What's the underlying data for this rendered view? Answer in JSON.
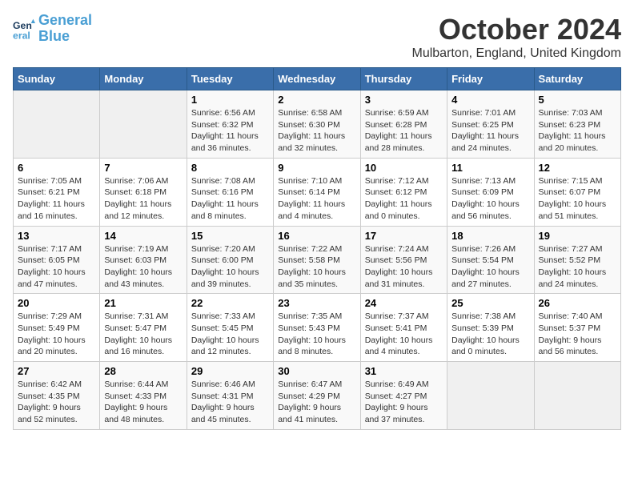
{
  "logo": {
    "line1": "General",
    "line2": "Blue"
  },
  "title": "October 2024",
  "location": "Mulbarton, England, United Kingdom",
  "days_of_week": [
    "Sunday",
    "Monday",
    "Tuesday",
    "Wednesday",
    "Thursday",
    "Friday",
    "Saturday"
  ],
  "weeks": [
    [
      {
        "day": "",
        "detail": ""
      },
      {
        "day": "",
        "detail": ""
      },
      {
        "day": "1",
        "detail": "Sunrise: 6:56 AM\nSunset: 6:32 PM\nDaylight: 11 hours\nand 36 minutes."
      },
      {
        "day": "2",
        "detail": "Sunrise: 6:58 AM\nSunset: 6:30 PM\nDaylight: 11 hours\nand 32 minutes."
      },
      {
        "day": "3",
        "detail": "Sunrise: 6:59 AM\nSunset: 6:28 PM\nDaylight: 11 hours\nand 28 minutes."
      },
      {
        "day": "4",
        "detail": "Sunrise: 7:01 AM\nSunset: 6:25 PM\nDaylight: 11 hours\nand 24 minutes."
      },
      {
        "day": "5",
        "detail": "Sunrise: 7:03 AM\nSunset: 6:23 PM\nDaylight: 11 hours\nand 20 minutes."
      }
    ],
    [
      {
        "day": "6",
        "detail": "Sunrise: 7:05 AM\nSunset: 6:21 PM\nDaylight: 11 hours\nand 16 minutes."
      },
      {
        "day": "7",
        "detail": "Sunrise: 7:06 AM\nSunset: 6:18 PM\nDaylight: 11 hours\nand 12 minutes."
      },
      {
        "day": "8",
        "detail": "Sunrise: 7:08 AM\nSunset: 6:16 PM\nDaylight: 11 hours\nand 8 minutes."
      },
      {
        "day": "9",
        "detail": "Sunrise: 7:10 AM\nSunset: 6:14 PM\nDaylight: 11 hours\nand 4 minutes."
      },
      {
        "day": "10",
        "detail": "Sunrise: 7:12 AM\nSunset: 6:12 PM\nDaylight: 11 hours\nand 0 minutes."
      },
      {
        "day": "11",
        "detail": "Sunrise: 7:13 AM\nSunset: 6:09 PM\nDaylight: 10 hours\nand 56 minutes."
      },
      {
        "day": "12",
        "detail": "Sunrise: 7:15 AM\nSunset: 6:07 PM\nDaylight: 10 hours\nand 51 minutes."
      }
    ],
    [
      {
        "day": "13",
        "detail": "Sunrise: 7:17 AM\nSunset: 6:05 PM\nDaylight: 10 hours\nand 47 minutes."
      },
      {
        "day": "14",
        "detail": "Sunrise: 7:19 AM\nSunset: 6:03 PM\nDaylight: 10 hours\nand 43 minutes."
      },
      {
        "day": "15",
        "detail": "Sunrise: 7:20 AM\nSunset: 6:00 PM\nDaylight: 10 hours\nand 39 minutes."
      },
      {
        "day": "16",
        "detail": "Sunrise: 7:22 AM\nSunset: 5:58 PM\nDaylight: 10 hours\nand 35 minutes."
      },
      {
        "day": "17",
        "detail": "Sunrise: 7:24 AM\nSunset: 5:56 PM\nDaylight: 10 hours\nand 31 minutes."
      },
      {
        "day": "18",
        "detail": "Sunrise: 7:26 AM\nSunset: 5:54 PM\nDaylight: 10 hours\nand 27 minutes."
      },
      {
        "day": "19",
        "detail": "Sunrise: 7:27 AM\nSunset: 5:52 PM\nDaylight: 10 hours\nand 24 minutes."
      }
    ],
    [
      {
        "day": "20",
        "detail": "Sunrise: 7:29 AM\nSunset: 5:49 PM\nDaylight: 10 hours\nand 20 minutes."
      },
      {
        "day": "21",
        "detail": "Sunrise: 7:31 AM\nSunset: 5:47 PM\nDaylight: 10 hours\nand 16 minutes."
      },
      {
        "day": "22",
        "detail": "Sunrise: 7:33 AM\nSunset: 5:45 PM\nDaylight: 10 hours\nand 12 minutes."
      },
      {
        "day": "23",
        "detail": "Sunrise: 7:35 AM\nSunset: 5:43 PM\nDaylight: 10 hours\nand 8 minutes."
      },
      {
        "day": "24",
        "detail": "Sunrise: 7:37 AM\nSunset: 5:41 PM\nDaylight: 10 hours\nand 4 minutes."
      },
      {
        "day": "25",
        "detail": "Sunrise: 7:38 AM\nSunset: 5:39 PM\nDaylight: 10 hours\nand 0 minutes."
      },
      {
        "day": "26",
        "detail": "Sunrise: 7:40 AM\nSunset: 5:37 PM\nDaylight: 9 hours\nand 56 minutes."
      }
    ],
    [
      {
        "day": "27",
        "detail": "Sunrise: 6:42 AM\nSunset: 4:35 PM\nDaylight: 9 hours\nand 52 minutes."
      },
      {
        "day": "28",
        "detail": "Sunrise: 6:44 AM\nSunset: 4:33 PM\nDaylight: 9 hours\nand 48 minutes."
      },
      {
        "day": "29",
        "detail": "Sunrise: 6:46 AM\nSunset: 4:31 PM\nDaylight: 9 hours\nand 45 minutes."
      },
      {
        "day": "30",
        "detail": "Sunrise: 6:47 AM\nSunset: 4:29 PM\nDaylight: 9 hours\nand 41 minutes."
      },
      {
        "day": "31",
        "detail": "Sunrise: 6:49 AM\nSunset: 4:27 PM\nDaylight: 9 hours\nand 37 minutes."
      },
      {
        "day": "",
        "detail": ""
      },
      {
        "day": "",
        "detail": ""
      }
    ]
  ]
}
